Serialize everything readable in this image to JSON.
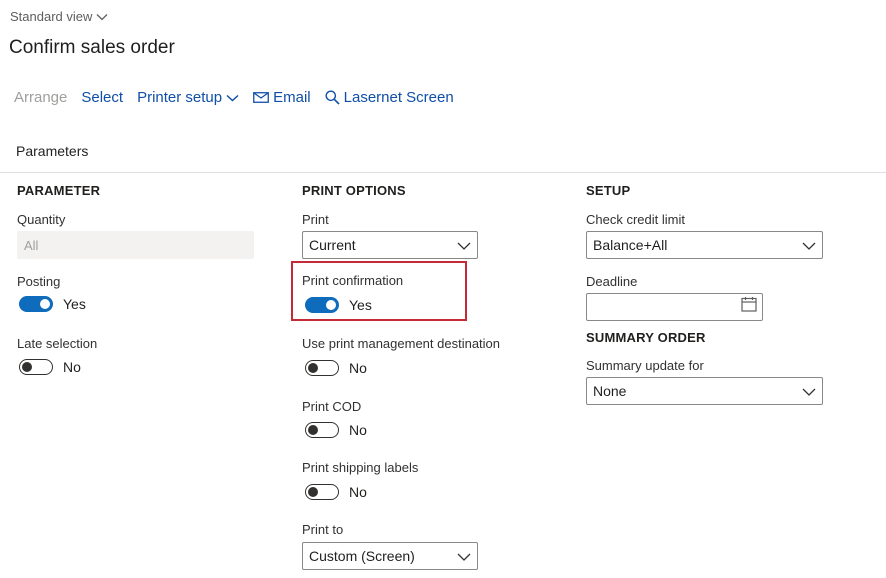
{
  "header": {
    "view_label": "Standard view",
    "title": "Confirm sales order"
  },
  "toolbar": {
    "arrange": "Arrange",
    "select": "Select",
    "printer_setup": "Printer setup",
    "email": "Email",
    "lasernet": "Lasernet Screen"
  },
  "section": {
    "label": "Parameters"
  },
  "parameter": {
    "heading": "PARAMETER",
    "quantity_label": "Quantity",
    "quantity_value": "All",
    "posting_label": "Posting",
    "posting_value": "Yes",
    "late_selection_label": "Late selection",
    "late_selection_value": "No"
  },
  "print_options": {
    "heading": "PRINT OPTIONS",
    "print_label": "Print",
    "print_value": "Current",
    "print_confirmation_label": "Print confirmation",
    "print_confirmation_value": "Yes",
    "use_pm_label": "Use print management destination",
    "use_pm_value": "No",
    "print_cod_label": "Print COD",
    "print_cod_value": "No",
    "print_shipping_label": "Print shipping labels",
    "print_shipping_value": "No",
    "print_to_label": "Print to",
    "print_to_value": "Custom (Screen)"
  },
  "setup": {
    "heading": "SETUP",
    "check_credit_label": "Check credit limit",
    "check_credit_value": "Balance+All",
    "deadline_label": "Deadline",
    "deadline_value": "",
    "summary_heading": "SUMMARY ORDER",
    "summary_update_label": "Summary update for",
    "summary_update_value": "None"
  },
  "colors": {
    "link": "#0f4fa8",
    "toggle_on": "#0f6cbd",
    "highlight": "#c42b36"
  }
}
